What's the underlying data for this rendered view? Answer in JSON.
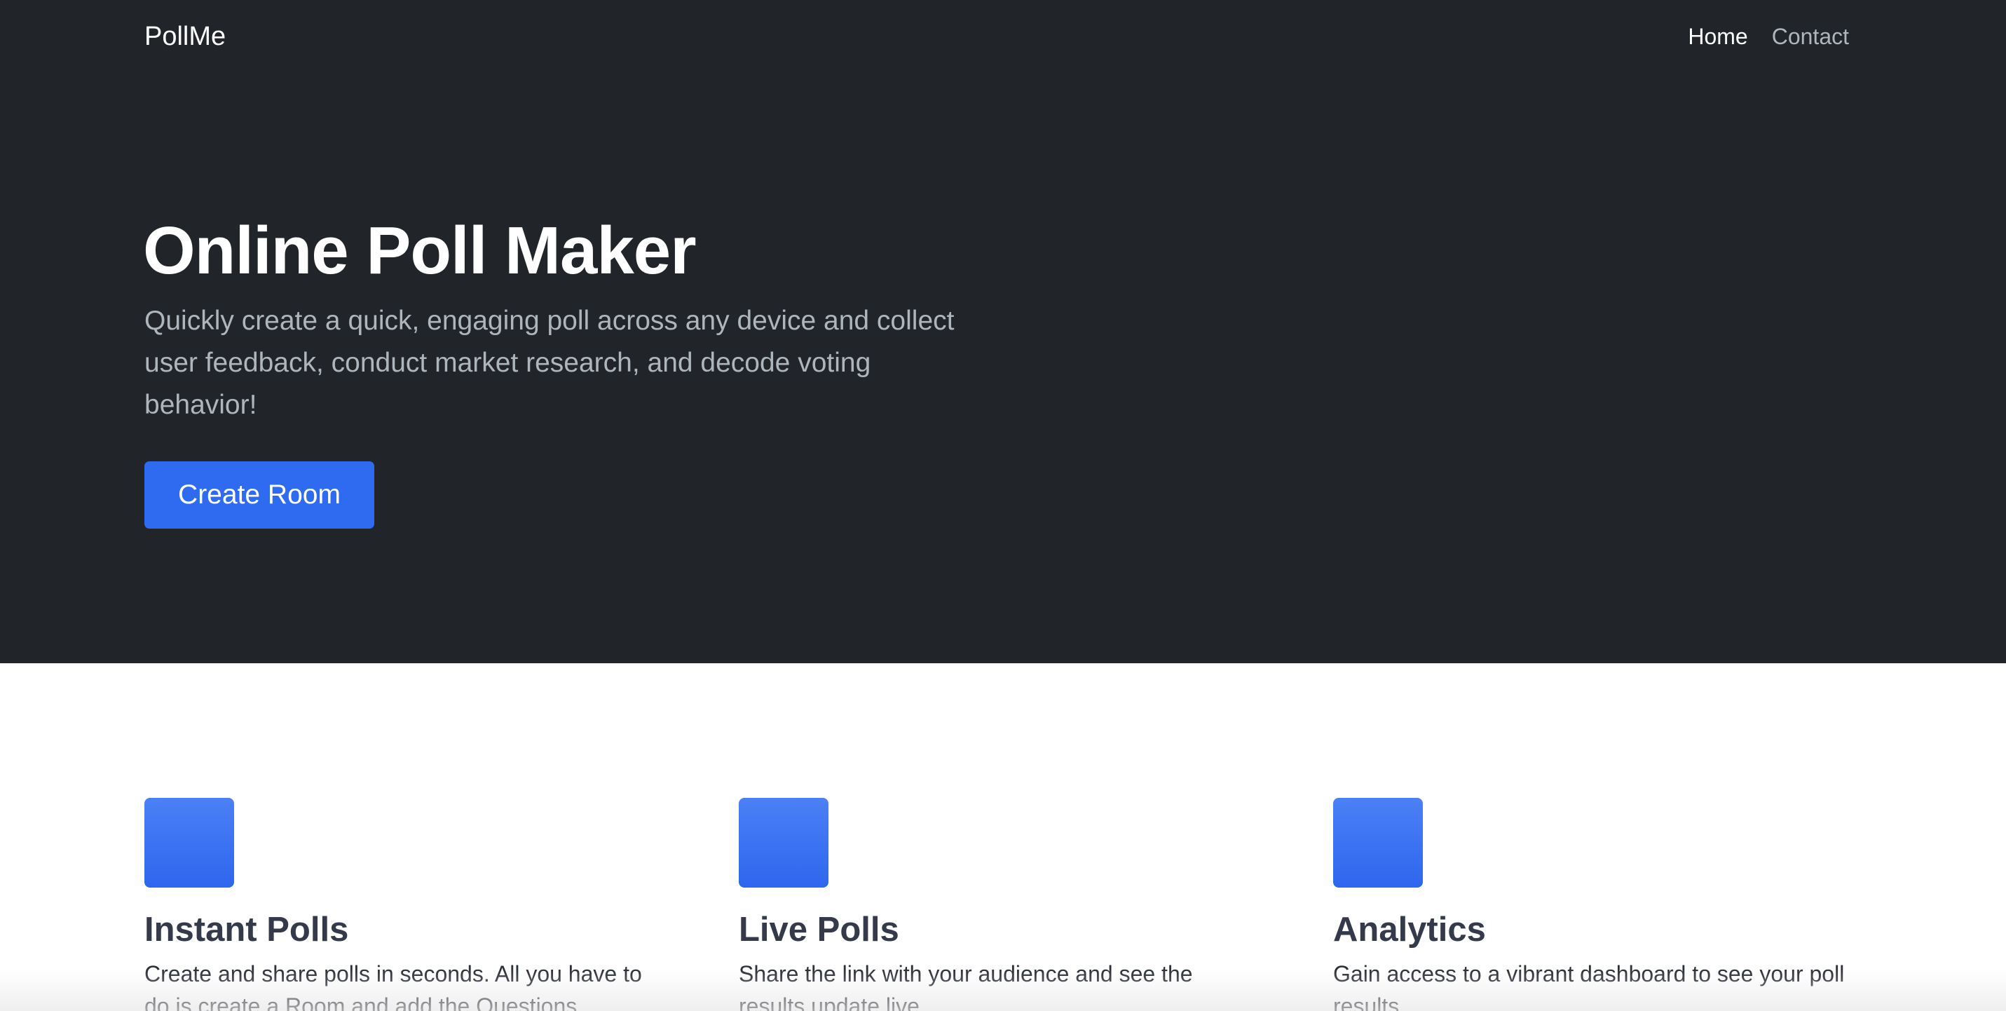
{
  "navbar": {
    "brand": "PollMe",
    "links": [
      {
        "label": "Home",
        "active": true
      },
      {
        "label": "Contact",
        "active": false
      }
    ]
  },
  "hero": {
    "title": "Online Poll Maker",
    "subtitle": "Quickly create a quick, engaging poll across any device and collect user feedback, conduct market research, and decode voting behavior!",
    "cta_label": "Create Room"
  },
  "features": [
    {
      "title": "Instant Polls",
      "description": "Create and share polls in seconds. All you have to do is create a Room and add the Questions."
    },
    {
      "title": "Live Polls",
      "description": "Share the link with your audience and see the results update live."
    },
    {
      "title": "Analytics",
      "description": "Gain access to a vibrant dashboard to see your poll results."
    }
  ],
  "colors": {
    "hero_bg": "#212529",
    "accent": "#2f6bf0",
    "muted_text": "#adb5bd"
  }
}
